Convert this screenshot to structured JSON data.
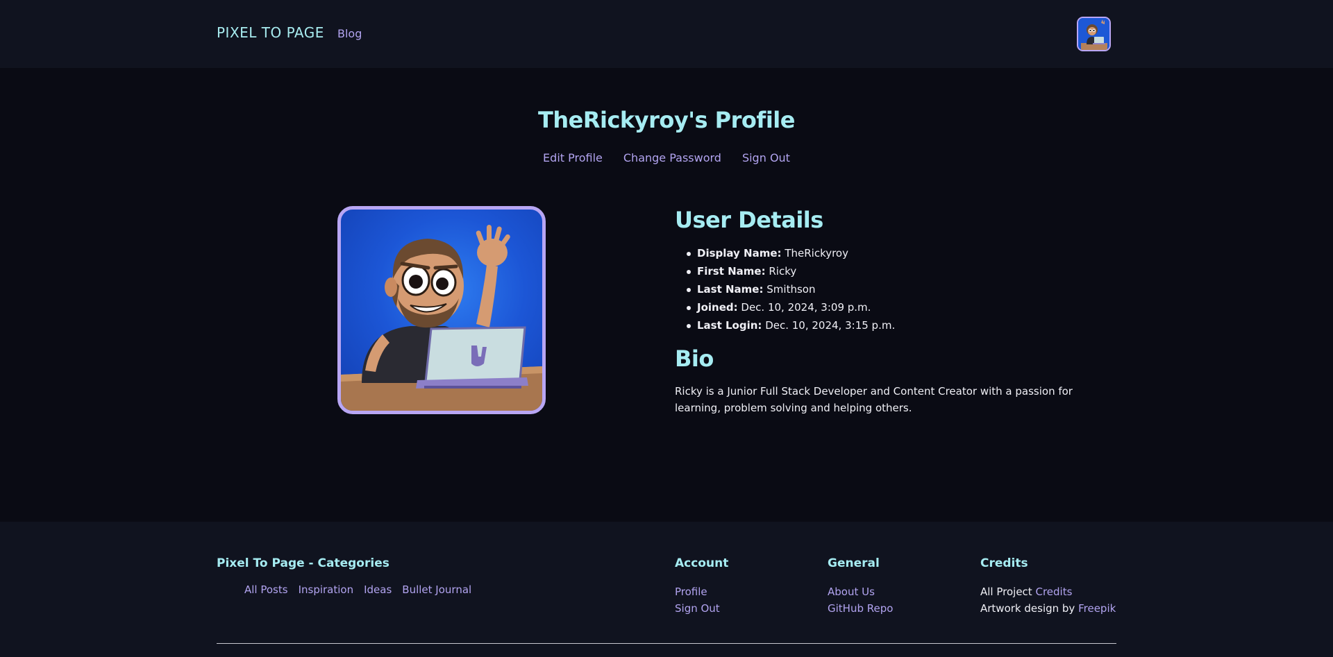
{
  "header": {
    "brand": "PIXEL TO PAGE",
    "nav_blog": "Blog",
    "avatar_icon": "user-avatar-icon"
  },
  "profile": {
    "title": "TheRickyroy's Profile",
    "actions": {
      "edit": "Edit Profile",
      "change_password": "Change Password",
      "sign_out": "Sign Out"
    },
    "image_icon": "cartoon-avatar-image"
  },
  "details": {
    "heading": "User Details",
    "items": [
      {
        "label": "Display Name:",
        "value": "TheRickyroy"
      },
      {
        "label": "First Name:",
        "value": "Ricky"
      },
      {
        "label": "Last Name:",
        "value": "Smithson"
      },
      {
        "label": "Joined:",
        "value": "Dec. 10, 2024, 3:09 p.m."
      },
      {
        "label": "Last Login:",
        "value": "Dec. 10, 2024, 3:15 p.m."
      }
    ]
  },
  "bio": {
    "heading": "Bio",
    "text": "Ricky is a Junior Full Stack Developer and Content Creator with a passion for learning, problem solving and helping others."
  },
  "footer": {
    "categories_heading": "Pixel To Page - Categories",
    "categories": [
      "All Posts",
      "Inspiration",
      "Ideas",
      "Bullet Journal"
    ],
    "account_heading": "Account",
    "account_links": [
      "Profile",
      "Sign Out"
    ],
    "general_heading": "General",
    "general_links": [
      "About Us",
      "GitHub Repo"
    ],
    "credits_heading": "Credits",
    "credits_line1_prefix": "All Project",
    "credits_line1_link": "Credits",
    "credits_line2_prefix": "Artwork design by",
    "credits_line2_link": "Freepik"
  },
  "colors": {
    "accent_cyan": "#a6ecf2",
    "accent_purple": "#b2a4f0",
    "background": "#0a0b14",
    "panel": "#10131f"
  }
}
